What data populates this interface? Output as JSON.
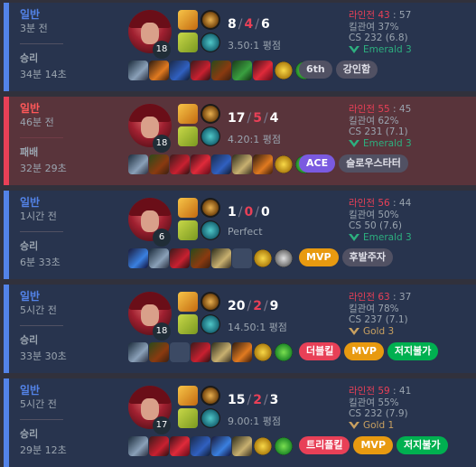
{
  "matches": [
    {
      "queue": "일반",
      "ago": "3분 전",
      "result": "승리",
      "duration": "34분 14초",
      "level": "18",
      "kills": "8",
      "deaths": "4",
      "assists": "6",
      "ratio": "3.50:1 평점",
      "lane_label": "라인전",
      "lane_a": "43",
      "lane_b": "57",
      "kill_part": "킬관여 37%",
      "cs": "CS 232 (6.8)",
      "rank": "Emerald 3",
      "rank_color": "#2daf7f",
      "tags": [
        "6th",
        "강인함"
      ]
    },
    {
      "queue": "일반",
      "ago": "46분 전",
      "result": "패배",
      "duration": "32분 29초",
      "level": "18",
      "kills": "17",
      "deaths": "5",
      "assists": "4",
      "ratio": "4.20:1 평점",
      "lane_label": "라인전",
      "lane_a": "55",
      "lane_b": "45",
      "kill_part": "킬관여 62%",
      "cs": "CS 231 (7.1)",
      "rank": "Emerald 3",
      "rank_color": "#2daf7f",
      "tags": [
        "ACE",
        "슬로우스타터"
      ]
    },
    {
      "queue": "일반",
      "ago": "1시간 전",
      "result": "승리",
      "duration": "6분 33초",
      "level": "6",
      "kills": "1",
      "deaths": "0",
      "assists": "0",
      "ratio": "Perfect",
      "lane_label": "라인전",
      "lane_a": "56",
      "lane_b": "44",
      "kill_part": "킬관여 50%",
      "cs": "CS 50 (7.6)",
      "rank": "Emerald 3",
      "rank_color": "#2daf7f",
      "tags": [
        "MVP",
        "후발주자"
      ]
    },
    {
      "queue": "일반",
      "ago": "5시간 전",
      "result": "승리",
      "duration": "33분 30초",
      "level": "18",
      "kills": "20",
      "deaths": "2",
      "assists": "9",
      "ratio": "14.50:1 평점",
      "lane_label": "라인전",
      "lane_a": "63",
      "lane_b": "37",
      "kill_part": "킬관여 78%",
      "cs": "CS 237 (7.1)",
      "rank": "Gold 3",
      "rank_color": "#c8a060",
      "tags": [
        "더블킬",
        "MVP",
        "저지불가"
      ]
    },
    {
      "queue": "일반",
      "ago": "5시간 전",
      "result": "승리",
      "duration": "29분 12초",
      "level": "17",
      "kills": "15",
      "deaths": "2",
      "assists": "3",
      "ratio": "9.00:1 평점",
      "lane_label": "라인전",
      "lane_a": "59",
      "lane_b": "41",
      "kill_part": "킬관여 55%",
      "cs": "CS 232 (7.9)",
      "rank": "Gold 1",
      "rank_color": "#c8a060",
      "tags": [
        "트리플킬",
        "MVP",
        "저지불가"
      ]
    }
  ]
}
